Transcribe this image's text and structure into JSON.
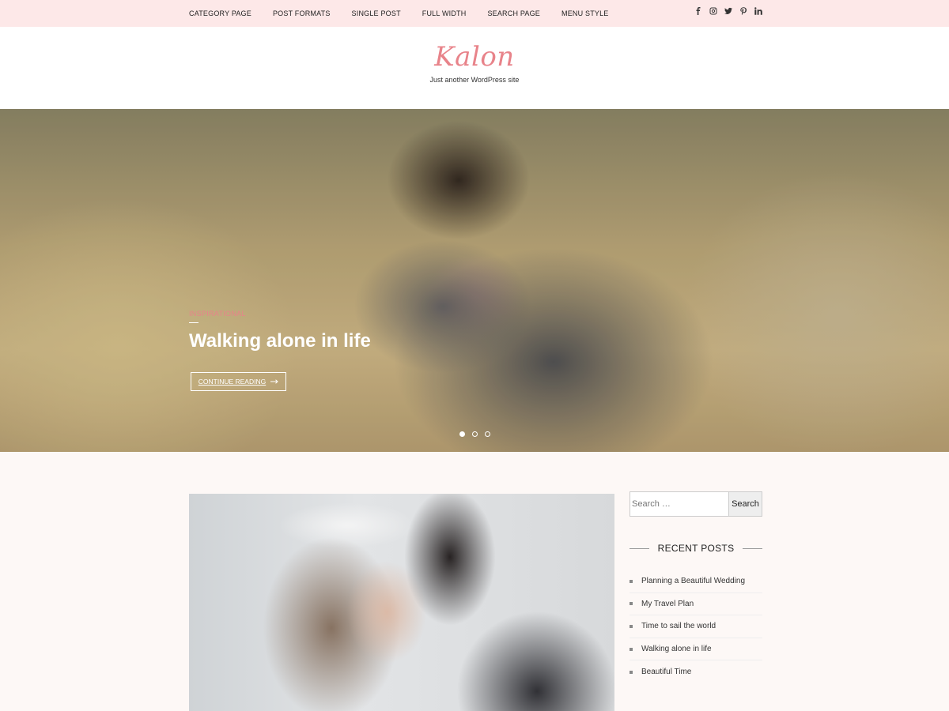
{
  "topbar": {
    "menu": [
      {
        "label": "CATEGORY PAGE"
      },
      {
        "label": "POST FORMATS"
      },
      {
        "label": "SINGLE POST"
      },
      {
        "label": "FULL WIDTH"
      },
      {
        "label": "SEARCH PAGE"
      },
      {
        "label": "MENU STYLE"
      }
    ],
    "social_icons": [
      "facebook-icon",
      "instagram-icon",
      "twitter-icon",
      "pinterest-icon",
      "linkedin-icon"
    ]
  },
  "header": {
    "site_title": "Kalon",
    "tagline": "Just another WordPress site"
  },
  "hero": {
    "category": "INSPIRATIONAL",
    "title": "Walking alone in life",
    "button_label": "CONTINUE READING",
    "slides": 3,
    "active_slide": 1
  },
  "sidebar": {
    "search": {
      "placeholder": "Search …",
      "button_label": "Search"
    },
    "recent_posts": {
      "title": "RECENT POSTS",
      "items": [
        {
          "label": "Planning a Beautiful Wedding"
        },
        {
          "label": "My Travel Plan"
        },
        {
          "label": "Time to sail the world"
        },
        {
          "label": "Walking alone in life"
        },
        {
          "label": "Beautiful Time"
        }
      ]
    }
  },
  "colors": {
    "accent": "#e8838a",
    "topbar_bg": "#fde8e8",
    "page_bg": "#fdf8f6"
  }
}
